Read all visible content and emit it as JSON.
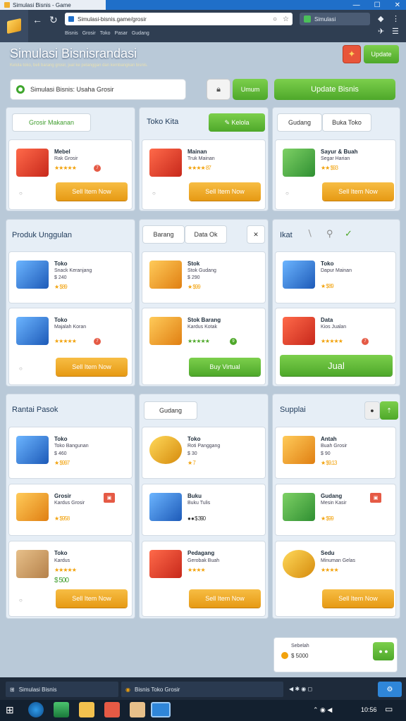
{
  "window": {
    "tab_title": "Simulasi Bisnis - Game",
    "controls": [
      "—",
      "☐",
      "✕"
    ]
  },
  "browser": {
    "url": "Simulasi-bisnis.game/grosir",
    "bookmarks": [
      "Bisnis",
      "Grosir",
      "Toko",
      "Pasar",
      "Gudang"
    ],
    "side_tab": "Simulasi"
  },
  "header": {
    "title": "Simulasi Bisnisrandasi",
    "subtitle": "Kelola toko, beli barang grosir, jual ke pelanggan dan kembangkan bisnis.",
    "update_label": "Update",
    "search_placeholder": "Simulasi Bisnis: Usaha Grosir",
    "small_green_label": "Umum",
    "large_green_label": "Update Bisnis"
  },
  "panels": [
    {
      "title": "Grosir Makanan",
      "chip": "Grosir Makanan"
    },
    {
      "title": "Toko Kita",
      "button": "Kelola"
    },
    {
      "title": "Gudang",
      "chip": "Buka Toko"
    },
    {
      "title": "Produk Unggulan"
    },
    {
      "chips": [
        "Barang",
        "Data Ok"
      ]
    },
    {
      "title": "Ikat"
    },
    {
      "title": "Rantai Pasok"
    },
    {
      "chip": "Gudang"
    },
    {
      "title": "Supplai"
    }
  ],
  "cards": [
    {
      "name": "Mebel",
      "desc": "Rak Grosir",
      "stars": "★★★★★",
      "badge": "7",
      "btn": "Sell Item Now"
    },
    {
      "name": "Mainan",
      "desc": "Truk Mainan",
      "stars": "★★★★ 87",
      "badge": "",
      "btn": "Sell Item Now"
    },
    {
      "name": "Sayur & Buah",
      "desc": "Segar Harian",
      "stars": "★★ $93",
      "badge": "",
      "btn": "Sell Item Now"
    },
    {
      "name": "Toko",
      "desc": "Snack Keranjang",
      "stars": "$ 240",
      "sub": "★ $89",
      "btn": ""
    },
    {
      "name": "Stok",
      "desc": "Stok Gudang",
      "stars": "$ 290",
      "sub": "★ $99",
      "btn": ""
    },
    {
      "name": "Toko",
      "desc": "Dapur Mainan",
      "stars": "★ $89",
      "btn": ""
    },
    {
      "name": "Toko",
      "desc": "Majalah Koran",
      "stars": "★★★★★",
      "badge": "7",
      "btn": "Sell Item Now"
    },
    {
      "name": "Stok Barang",
      "desc": "Kardus Kotak",
      "stars": "★★★★★",
      "badge": "9",
      "btn": "Buy Virtual"
    },
    {
      "name": "Data",
      "desc": "Kios Jualan",
      "stars": "★★★★★",
      "badge": "7",
      "btn": "Jual"
    },
    {
      "name": "Toko",
      "desc": "Toko Bangunan",
      "stars": "$ 460",
      "sub": "★ $997",
      "btn": ""
    },
    {
      "name": "Toko",
      "desc": "Roti Panggang",
      "stars": "$ 30",
      "sub": "★ 7",
      "btn": ""
    },
    {
      "name": "Antah",
      "desc": "Buah Grosir",
      "stars": "$ 90",
      "sub": "★ $9.13",
      "btn": ""
    },
    {
      "name": "Grosir",
      "desc": "Kardus Grosir",
      "stars": "★ $958",
      "btn": ""
    },
    {
      "name": "Buku",
      "desc": "Buku Tulis",
      "stars": "● ● $ 390",
      "btn": ""
    },
    {
      "name": "Gudang",
      "desc": "Mesin Kasir",
      "stars": "★ $99",
      "btn": ""
    },
    {
      "name": "Toko",
      "desc": "Kardus",
      "stars": "★★★★★",
      "sub": "$ 500",
      "btn": "Sell Item Now"
    },
    {
      "name": "Pedagang",
      "desc": "Gerobak Buah",
      "stars": "★★★★",
      "btn": "Sell Item Now"
    },
    {
      "name": "Sedu",
      "desc": "Minuman Gelas",
      "stars": "★★★★",
      "btn": "Sell Item Now"
    }
  ],
  "mini": {
    "label": "Sebelah",
    "value": "$ 5000"
  },
  "taskbar": {
    "windows": [
      "Simulasi Bisnis",
      "Bisnis Toko Grosir"
    ],
    "clock": "10:56"
  },
  "colors": {
    "accent_green": "#4ea82a",
    "accent_orange": "#e69a14",
    "brand_blue": "#1f6fc9"
  }
}
